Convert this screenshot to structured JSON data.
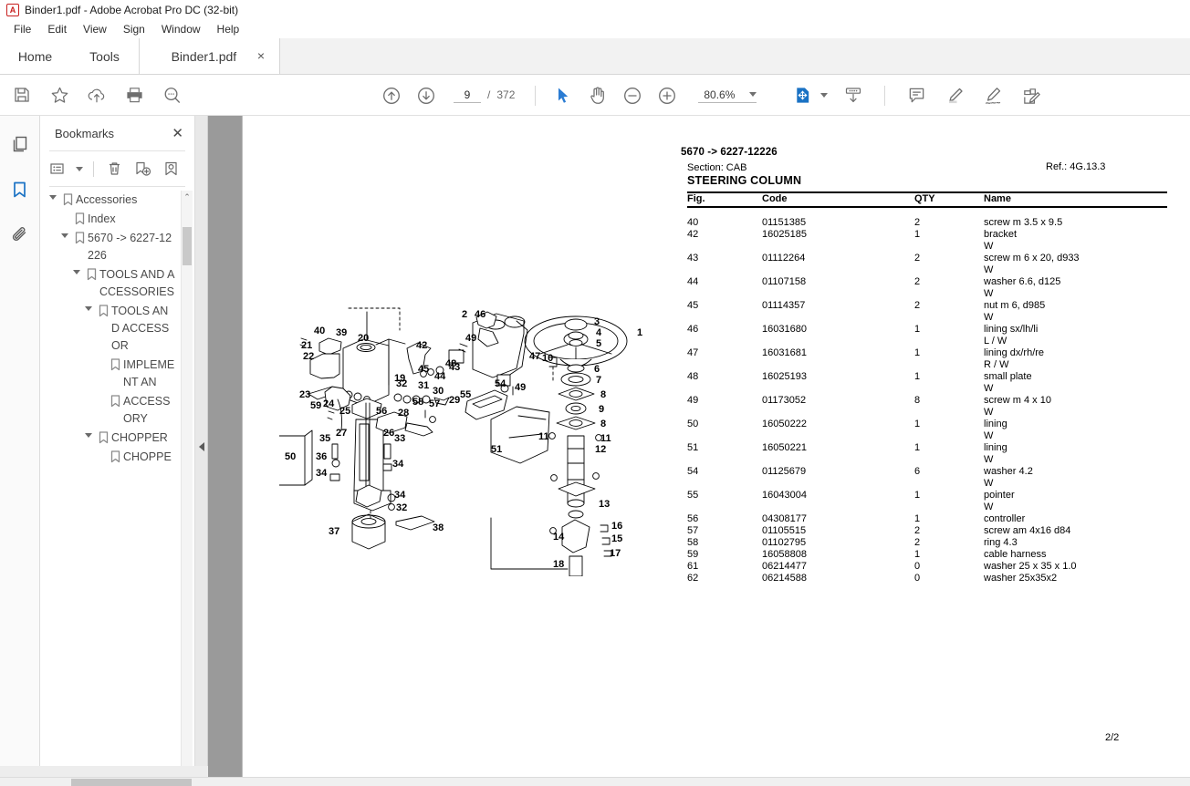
{
  "window": {
    "title": "Binder1.pdf - Adobe Acrobat Pro DC (32-bit)",
    "app_icon": "acrobat-logo-icon"
  },
  "menu": {
    "items": [
      {
        "label": "File"
      },
      {
        "label": "Edit"
      },
      {
        "label": "View"
      },
      {
        "label": "Sign"
      },
      {
        "label": "Window"
      },
      {
        "label": "Help"
      }
    ]
  },
  "tabs": {
    "home_label": "Home",
    "tools_label": "Tools",
    "document_label": "Binder1.pdf",
    "close_glyph": "×"
  },
  "toolbar": {
    "left_icons": [
      {
        "name": "save-icon"
      },
      {
        "name": "star-icon"
      },
      {
        "name": "upload-cloud-icon"
      },
      {
        "name": "print-icon"
      },
      {
        "name": "zoom-search-icon"
      }
    ],
    "page_prev_icon": "arrow-up-circle-icon",
    "page_next_icon": "arrow-down-circle-icon",
    "page_current": "9",
    "page_separator": "/",
    "page_total": "372",
    "select_tool_icon": "cursor-arrow-icon",
    "hand_tool_icon": "hand-icon",
    "zoom_out_icon": "minus-circle-icon",
    "zoom_in_icon": "plus-circle-icon",
    "zoom_level": "80.6%",
    "zoom_dropdown_icon": "chevron-down-icon",
    "fit_page_icon": "fit-page-icon",
    "fit_dropdown_icon": "chevron-down-icon",
    "scroll_mode_icon": "page-scroll-icon",
    "right_icons": [
      {
        "name": "comment-icon"
      },
      {
        "name": "highlight-pen-icon"
      },
      {
        "name": "sign-pen-icon"
      },
      {
        "name": "fill-and-sign-icon"
      }
    ]
  },
  "rail": {
    "items": [
      {
        "name": "page-thumbnails-icon",
        "active": false
      },
      {
        "name": "bookmarks-icon",
        "active": true
      },
      {
        "name": "attachments-icon",
        "active": false
      }
    ]
  },
  "panel": {
    "title": "Bookmarks",
    "close_glyph": "✕",
    "tools": [
      {
        "name": "bookmark-options-icon"
      },
      {
        "name": "delete-bookmark-icon"
      },
      {
        "name": "new-bookmark-icon"
      },
      {
        "name": "edit-bookmark-icon"
      }
    ],
    "scroll_up_glyph": "⌃",
    "scroll_down_glyph": "⌄",
    "bookmarks": [
      {
        "label": "Accessories",
        "indent": 0,
        "expandable": true
      },
      {
        "label": "Index",
        "indent": 1,
        "expandable": false
      },
      {
        "label": "5670 -> 6227-12226",
        "indent": 1,
        "expandable": true
      },
      {
        "label": "TOOLS AND ACCESSORIES",
        "indent": 2,
        "expandable": true
      },
      {
        "label": "TOOLS AND ACCESSOR",
        "indent": 3,
        "expandable": true
      },
      {
        "label": "IMPLEMENT AN",
        "indent": 4,
        "expandable": false
      },
      {
        "label": "ACCESSORY",
        "indent": 4,
        "expandable": false
      },
      {
        "label": "CHOPPER",
        "indent": 3,
        "expandable": true
      },
      {
        "label": "CHOPPE",
        "indent": 4,
        "expandable": false
      }
    ]
  },
  "collapse_handle": {
    "name": "collapse-nav-pane-arrow"
  },
  "document": {
    "title": "5670 -> 6227-12226",
    "section_label": "Section: CAB",
    "ref_label": "Ref.: 4G.13.3",
    "heading": "STEERING COLUMN",
    "page_number": "2/2",
    "columns": {
      "fig": "Fig.",
      "code": "Code",
      "qty": "QTY",
      "name": "Name"
    },
    "rows": [
      {
        "fig": "40",
        "code": "01151385",
        "qty": "2",
        "name": "screw m 3.5 x 9.5",
        "sub": ""
      },
      {
        "fig": "42",
        "code": "16025185",
        "qty": "1",
        "name": "bracket",
        "sub": "W"
      },
      {
        "fig": "43",
        "code": "01112264",
        "qty": "2",
        "name": "screw m 6 x 20, d933",
        "sub": "W"
      },
      {
        "fig": "44",
        "code": "01107158",
        "qty": "2",
        "name": "washer 6.6, d125",
        "sub": "W"
      },
      {
        "fig": "45",
        "code": "01114357",
        "qty": "2",
        "name": "nut m 6, d985",
        "sub": "W"
      },
      {
        "fig": "46",
        "code": "16031680",
        "qty": "1",
        "name": "lining sx/lh/li",
        "sub": "L / W"
      },
      {
        "fig": "47",
        "code": "16031681",
        "qty": "1",
        "name": "lining dx/rh/re",
        "sub": "R / W"
      },
      {
        "fig": "48",
        "code": "16025193",
        "qty": "1",
        "name": "small plate",
        "sub": "W"
      },
      {
        "fig": "49",
        "code": "01173052",
        "qty": "8",
        "name": "screw m 4 x 10",
        "sub": "W"
      },
      {
        "fig": "50",
        "code": "16050222",
        "qty": "1",
        "name": "lining",
        "sub": "W"
      },
      {
        "fig": "51",
        "code": "16050221",
        "qty": "1",
        "name": "lining",
        "sub": "W"
      },
      {
        "fig": "54",
        "code": "01125679",
        "qty": "6",
        "name": "washer 4.2",
        "sub": "W"
      },
      {
        "fig": "55",
        "code": "16043004",
        "qty": "1",
        "name": "pointer",
        "sub": "W"
      },
      {
        "fig": "56",
        "code": "04308177",
        "qty": "1",
        "name": "controller",
        "sub": ""
      },
      {
        "fig": "57",
        "code": "01105515",
        "qty": "2",
        "name": "screw am 4x16 d84",
        "sub": ""
      },
      {
        "fig": "58",
        "code": "01102795",
        "qty": "2",
        "name": "ring 4.3",
        "sub": ""
      },
      {
        "fig": "59",
        "code": "16058808",
        "qty": "1",
        "name": "cable harness",
        "sub": ""
      },
      {
        "fig": "61",
        "code": "06214477",
        "qty": "0",
        "name": "washer 25 x 35 x 1.0",
        "sub": ""
      },
      {
        "fig": "62",
        "code": "06214588",
        "qty": "0",
        "name": "washer 25x35x2",
        "sub": ""
      }
    ],
    "diagram": {
      "name": "steering-column-exploded-view",
      "callouts": [
        "1",
        "2",
        "3",
        "4",
        "5",
        "6",
        "7",
        "8",
        "9",
        "10",
        "11",
        "12",
        "13",
        "14",
        "15",
        "16",
        "17",
        "18",
        "19",
        "20",
        "21",
        "22",
        "23",
        "24",
        "25",
        "26",
        "27",
        "28",
        "29",
        "30",
        "31",
        "32",
        "33",
        "34",
        "35",
        "36",
        "37",
        "38",
        "39",
        "40",
        "42",
        "43",
        "44",
        "45",
        "46",
        "47",
        "48",
        "49",
        "50",
        "51",
        "54",
        "55",
        "56",
        "57",
        "58",
        "59"
      ]
    }
  },
  "colors": {
    "accent": "#1a72c4",
    "viewer_background": "#9a9a9a",
    "panel_border": "#dcdcdc",
    "toolbar_icon": "#6e6e6e"
  }
}
